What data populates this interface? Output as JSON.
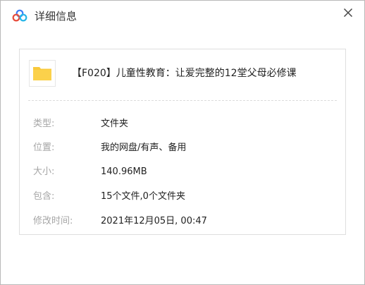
{
  "window": {
    "title": "详细信息",
    "icons": {
      "app": "baidu-netdisk-cloud-icon",
      "close": "close-icon",
      "folder": "folder-icon"
    },
    "colors": {
      "folder": "#f9c93b",
      "label": "#a6a6a6",
      "value": "#222222"
    }
  },
  "file": {
    "name": "【F020】儿童性教育：让爱完整的12堂父母必修课"
  },
  "details": [
    {
      "label": "类型:",
      "value": "文件夹"
    },
    {
      "label": "位置:",
      "value": "我的网盘/有声、备用"
    },
    {
      "label": "大小:",
      "value": "140.96MB"
    },
    {
      "label": "包含:",
      "value": "15个文件,0个文件夹"
    },
    {
      "label": "修改时间:",
      "value": "2021年12月05日, 00:47"
    }
  ]
}
